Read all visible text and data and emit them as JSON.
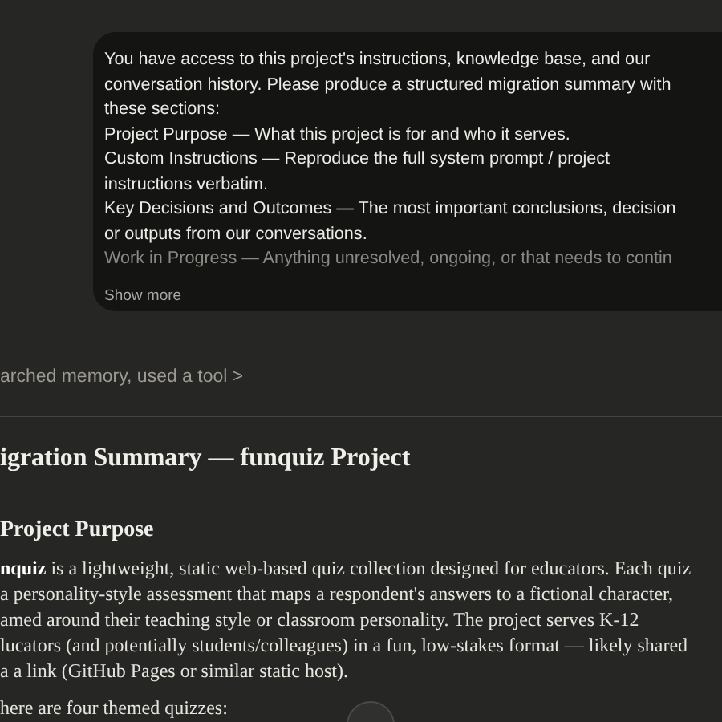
{
  "prompt": {
    "paragraphs": [
      [
        "You have access to this project's instructions, knowledge base, and our",
        "conversation history. Please produce a structured migration summary with",
        "these sections:"
      ],
      [
        "Project Purpose — What this project is for and who it serves."
      ],
      [
        "Custom Instructions — Reproduce the full system prompt / project",
        "instructions verbatim."
      ],
      [
        "Key Decisions and Outcomes — The most important conclusions, decision",
        "or outputs from our conversations."
      ],
      [
        "Work in Progress — Anything unresolved, ongoing, or that needs to contin"
      ]
    ],
    "show_more": "Show more"
  },
  "tool_summary": {
    "label": "arched memory, used a tool",
    "chevron": ">"
  },
  "response": {
    "title": "igration Summary — funquiz Project",
    "section_heading": "Project Purpose",
    "paragraph_lines": [
      "**nquiz** is a lightweight, static web-based quiz collection designed for educators. Each quiz",
      "a personality-style assessment that maps a respondent's answers to a fictional character,",
      "amed around their teaching style or classroom personality. The project serves K-12",
      "lucators (and potentially students/colleagues) in a fun, low-stakes format — likely shared",
      "a a link (GitHub Pages or similar static host)."
    ],
    "next_line": "here are four themed quizzes:"
  }
}
